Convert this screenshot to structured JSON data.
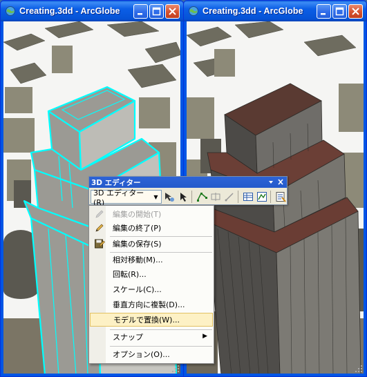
{
  "left_window": {
    "title": "Creating.3dd - ArcGlobe",
    "buttons": [
      "minimize",
      "maximize",
      "close"
    ]
  },
  "right_window": {
    "title": "Creating.3dd - ArcGlobe",
    "buttons": [
      "minimize",
      "maximize",
      "close"
    ]
  },
  "editor_toolbar": {
    "title": "3D エディター",
    "dropdown_label": "3D エディター(R)"
  },
  "menu": {
    "items": [
      {
        "label": "編集の開始(T)",
        "enabled": false,
        "icon": "pencil-icon"
      },
      {
        "label": "編集の終了(P)",
        "enabled": true,
        "icon": "pencil-stop-icon"
      },
      {
        "label": "編集の保存(S)",
        "enabled": true,
        "icon": "save-edits-icon"
      },
      {
        "label": "相対移動(M)...",
        "enabled": true
      },
      {
        "label": "回転(R)...",
        "enabled": true
      },
      {
        "label": "スケール(C)...",
        "enabled": true
      },
      {
        "label": "垂直方向に複製(D)...",
        "enabled": true
      },
      {
        "label": "モデルで置換(W)...",
        "enabled": true,
        "highlighted": true
      },
      {
        "label": "スナップ",
        "enabled": true,
        "submenu": true
      },
      {
        "label": "オプション(O)...",
        "enabled": true
      }
    ]
  },
  "colors": {
    "selection_outline": "#00ffff",
    "titlebar": "#0b5ee6",
    "menu_highlight": "#fdf1c5"
  }
}
